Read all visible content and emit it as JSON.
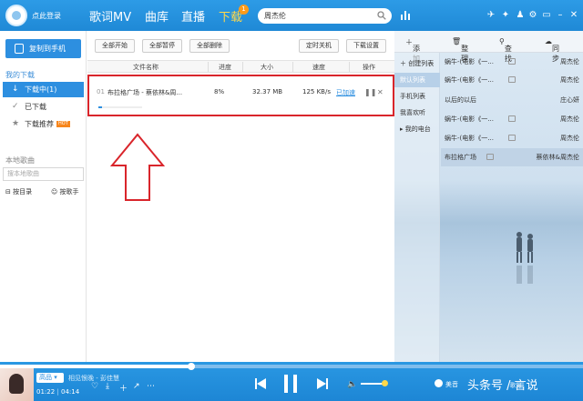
{
  "top": {
    "login": "点此登录",
    "nav": [
      "歌词MV",
      "曲库",
      "直播",
      "下载"
    ],
    "download_badge": "1",
    "search_value": "周杰伦"
  },
  "left": {
    "copy_button": "复制到手机",
    "my_downloads": "我的下载",
    "items": [
      {
        "label": "下载中(1)",
        "icon": "download-icon"
      },
      {
        "label": "已下载",
        "icon": "check-icon"
      },
      {
        "label": "下载推荐",
        "icon": "star-icon",
        "badge": "HOT"
      }
    ],
    "local_songs": "本地歌曲",
    "local_search_placeholder": "搜本地歌曲",
    "by_dir": "按目录",
    "by_singer": "按歌手"
  },
  "middle": {
    "buttons": {
      "start_all": "全部开始",
      "pause_all": "全部暂停",
      "delete_all": "全部删除",
      "timed_shutdown": "定时关机",
      "download_settings": "下载设置"
    },
    "columns": [
      "文件名称",
      "进度",
      "大小",
      "速度",
      "操作"
    ],
    "row": {
      "index": "01",
      "name": "布拉格广场 - 蔡依林&周...",
      "progress": "8%",
      "size": "32.37 MB",
      "speed": "125 KB/s",
      "speedup": "已加速"
    },
    "progress_value": 0.08
  },
  "right": {
    "tools": [
      "添加",
      "整理",
      "查找",
      "同步"
    ],
    "lists": [
      "创建列表",
      "默认列表",
      "手机列表",
      "我喜欢听",
      "我的电台"
    ],
    "songs": [
      {
        "title": "蜗牛-(电影《一...",
        "artist": "周杰伦"
      },
      {
        "title": "蜗牛-(电影《一...",
        "artist": "周杰伦"
      },
      {
        "title": "以后的以后",
        "artist": "庄心妍"
      },
      {
        "title": "蜗牛-(电影《一...",
        "artist": "周杰伦"
      },
      {
        "title": "蜗牛-(电影《一...",
        "artist": "周杰伦"
      },
      {
        "title": "布拉格广场",
        "artist": "蔡依林&周杰伦"
      }
    ]
  },
  "player": {
    "quality": "高品",
    "song": "相见恨晚 - 彭佳慧",
    "elapsed": "01:22",
    "total": "04:14",
    "seek_fraction": 0.33,
    "mode": "美音",
    "watermark": "头条号 / 言说",
    "lyric_btn": "歌词"
  },
  "colors": {
    "accent": "#2d8fe0",
    "highlight_box": "#d9252b",
    "active_nav": "#ffd84a"
  }
}
